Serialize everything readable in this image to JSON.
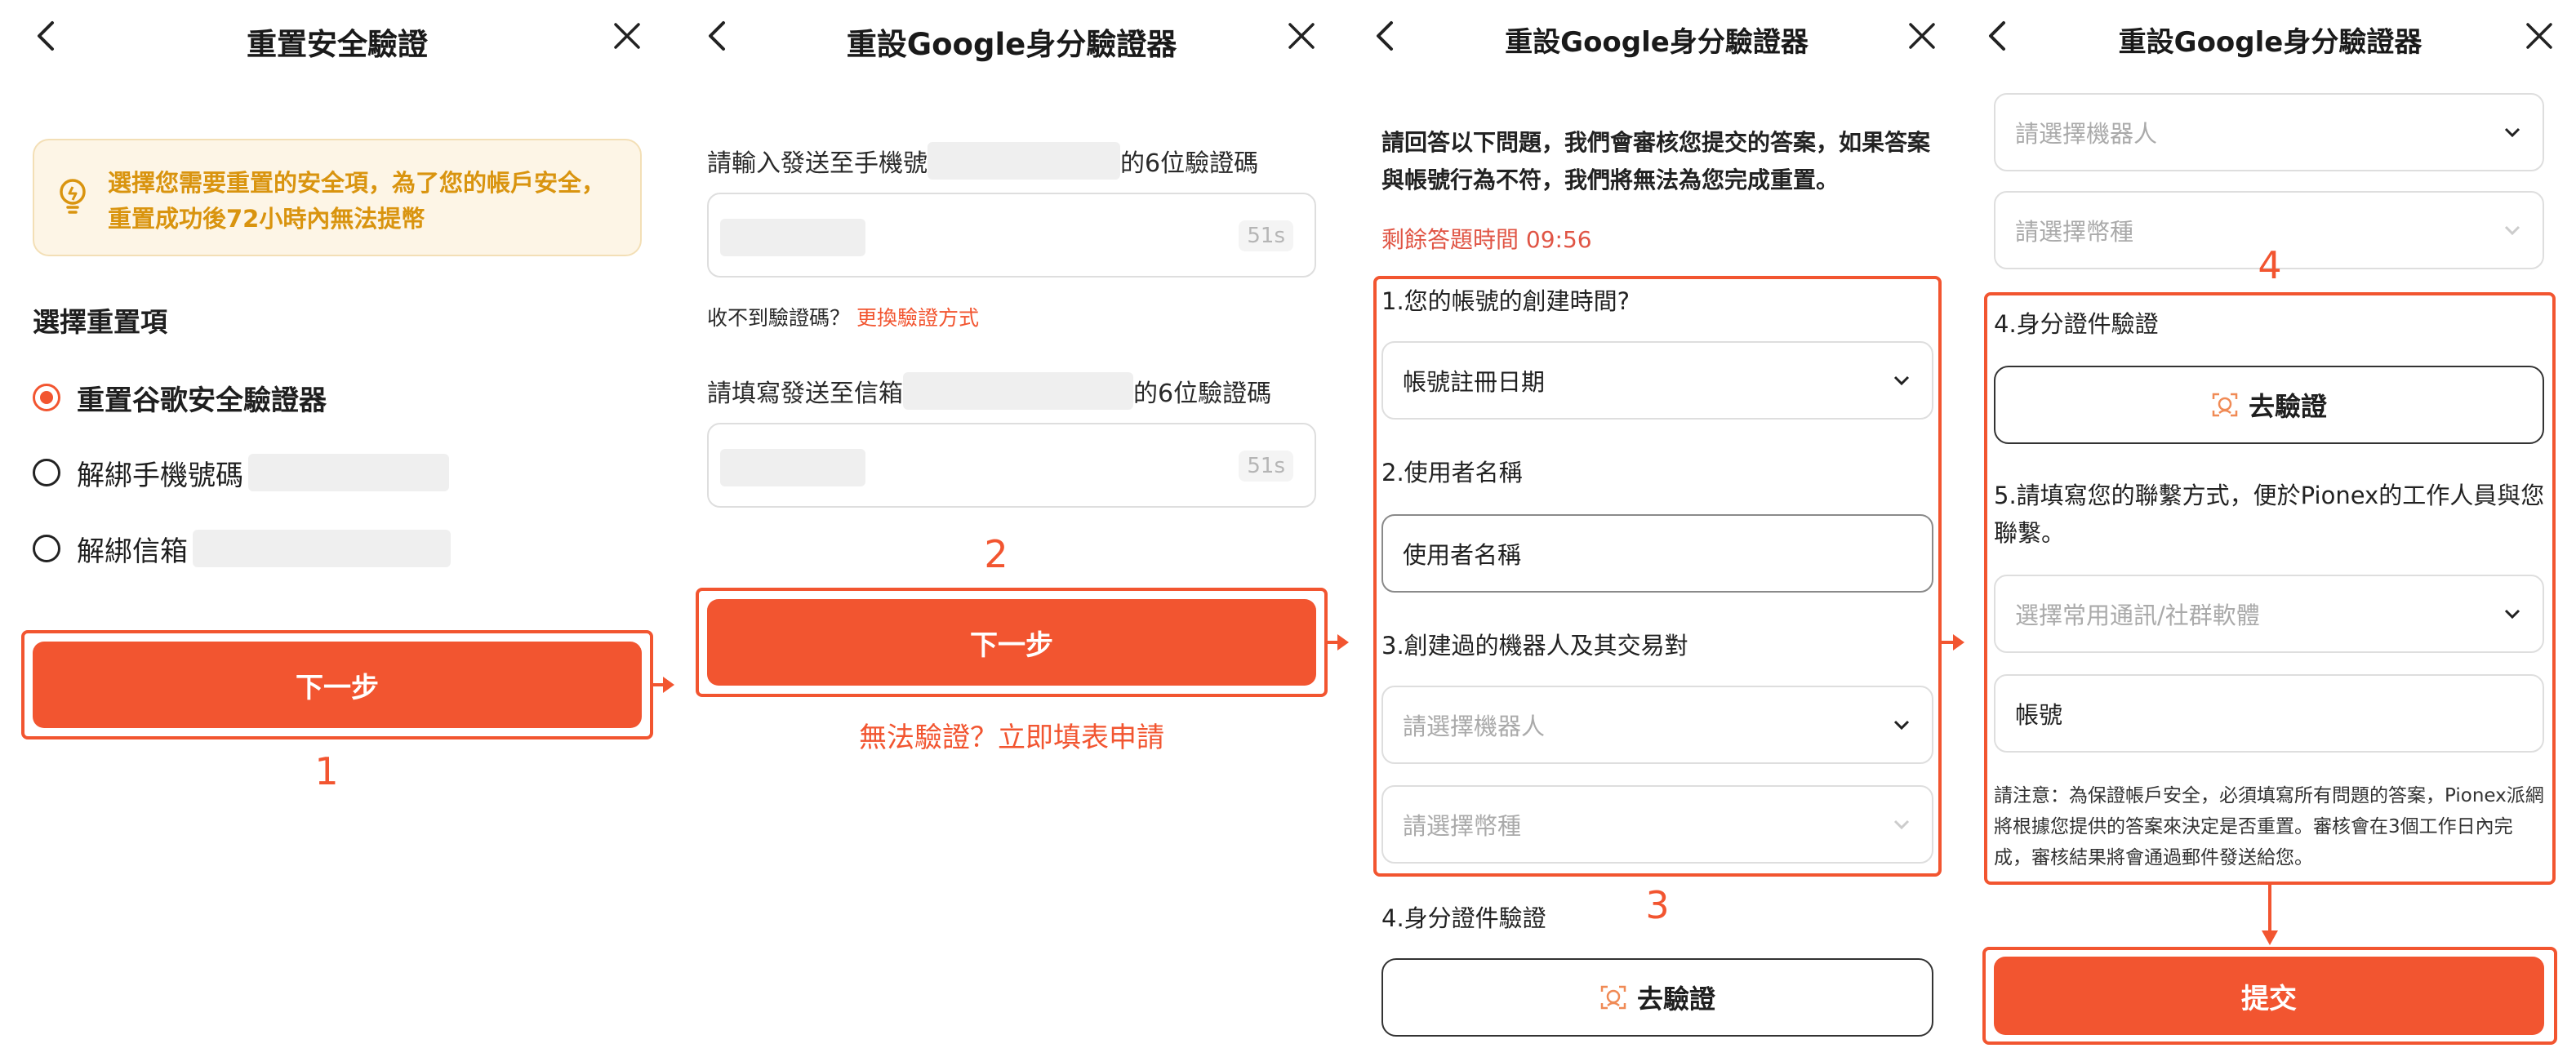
{
  "colors": {
    "accent": "#f25530",
    "warning_text": "#d9940f",
    "warning_bg": "#fdf5e6",
    "timer_red": "#e05545"
  },
  "panel1": {
    "title": "重置安全驗證",
    "notice": "選擇您需要重置的安全項，為了您的帳戶安全，重置成功後72小時內無法提幣",
    "section_title": "選擇重置項",
    "options": [
      {
        "label": "重置谷歌安全驗證器",
        "selected": true
      },
      {
        "label": "解綁手機號碼",
        "selected": false
      },
      {
        "label": "解綁信箱",
        "selected": false
      }
    ],
    "next_button": "下一步",
    "step_marker": "1"
  },
  "panel2": {
    "title": "重設Google身分驗證器",
    "phone_prompt_prefix": "請輸入發送至手機號",
    "phone_prompt_suffix": "的6位驗證碼",
    "phone_timer": "51s",
    "no_code_text": "收不到驗證碼？",
    "switch_method": "更換驗證方式",
    "email_prompt_prefix": "請填寫發送至信箱",
    "email_prompt_suffix": "的6位驗證碼",
    "email_timer": "51s",
    "next_button": "下一步",
    "fallback_link": "無法驗證？立即填表申請",
    "step_marker": "2"
  },
  "panel3": {
    "title": "重設Google身分驗證器",
    "intro": "請回答以下問題，我們會審核您提交的答案，如果答案與帳號行為不符，我們將無法為您完成重置。",
    "countdown": "剩餘答題時間 09:56",
    "q1": "1.您的帳號的創建時間?",
    "q1_select": "帳號註冊日期",
    "q2": "2.使用者名稱",
    "q2_input": "使用者名稱",
    "q3": "3.創建過的機器人及其交易對",
    "q3_bot_placeholder": "請選擇機器人",
    "q3_coin_placeholder": "請選擇幣種",
    "q4": "4.身分證件驗證",
    "verify_button": "去驗證",
    "step_marker": "3"
  },
  "panel4": {
    "title": "重設Google身分驗證器",
    "bot_placeholder": "請選擇機器人",
    "coin_placeholder": "請選擇幣種",
    "q4": "4.身分證件驗證",
    "verify_button": "去驗證",
    "q5": "5.請填寫您的聯繫方式，便於Pionex的工作人員與您聯繫。",
    "contact_placeholder": "選擇常用通訊/社群軟體",
    "account_input": "帳號",
    "note": "請注意：為保證帳戶安全，必須填寫所有問題的答案，Pionex派網將根據您提供的答案來決定是否重置。審核會在3個工作日內完成，審核結果將會通過郵件發送給您。",
    "submit_button": "提交",
    "step_marker": "4"
  }
}
